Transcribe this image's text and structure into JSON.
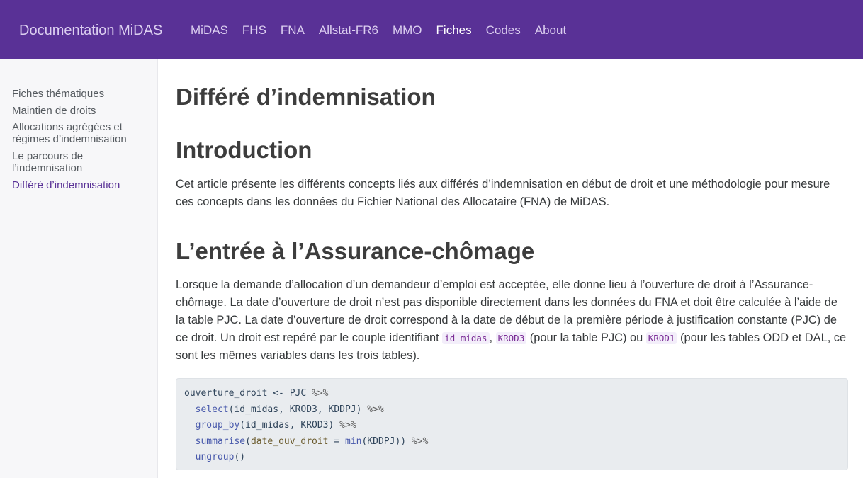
{
  "navbar": {
    "brand": "Documentation MiDAS",
    "items": [
      {
        "label": "MiDAS"
      },
      {
        "label": "FHS"
      },
      {
        "label": "FNA"
      },
      {
        "label": "Allstat-FR6"
      },
      {
        "label": "MMO"
      },
      {
        "label": "Fiches",
        "active": true
      },
      {
        "label": "Codes"
      },
      {
        "label": "About"
      }
    ]
  },
  "sidebar": {
    "items": [
      {
        "label": "Fiches thématiques"
      },
      {
        "label": "Maintien de droits"
      },
      {
        "label": "Allocations agrégées et régimes d’indemnisation"
      },
      {
        "label": "Le parcours de l’indemnisation"
      },
      {
        "label": "Différé d’indemnisation",
        "active": true
      }
    ]
  },
  "main": {
    "title": "Différé d’indemnisation",
    "intro_heading": "Introduction",
    "intro_text": "Cet article présente les différents concepts liés aux différés d’indemnisation en début de droit et une méthodologie pour mesure ces concepts dans les données du Fichier National des Allocataire (FNA) de MiDAS.",
    "entry_heading": "L’entrée à l’Assurance-chômage",
    "entry_text_1": "Lorsque la demande d’allocation d’un demandeur d’emploi est acceptée, elle donne lieu à l’ouverture de droit à l’Assurance-chômage. La date d’ouverture de droit n’est pas disponible directement dans les données du FNA et doit être calculée à l’aide de la table PJC. La date d’ouverture de droit correspond à la date de début de la première période à justification constante (PJC) de ce droit. Un droit est repéré par le couple identifiant ",
    "code_id_midas": "id_midas",
    "comma": ", ",
    "code_krod3": "KROD3",
    "entry_text_2": " (pour la table PJC) ou ",
    "code_krod1": "KROD1",
    "entry_text_3": " (pour les tables ODD et DAL, ce sont les mêmes variables dans les trois tables).",
    "code": {
      "l1_a": "ouverture_droit <- PJC ",
      "l1_op": "%>%",
      "l2_fn": "select",
      "l2_args": "(id_midas, KROD3, KDDPJ) ",
      "l2_op": "%>%",
      "l3_fn": "group_by",
      "l3_args": "(id_midas, KROD3) ",
      "l3_op": "%>%",
      "l4_fn": "summarise",
      "l4_paren": "(",
      "l4_arg": "date_ouv_droit",
      "l4_eq": " = ",
      "l4_fn2": "min",
      "l4_rest": "(KDDPJ)) ",
      "l4_op": "%>%",
      "l5_fn": "ungroup",
      "l5_rest": "()"
    }
  }
}
